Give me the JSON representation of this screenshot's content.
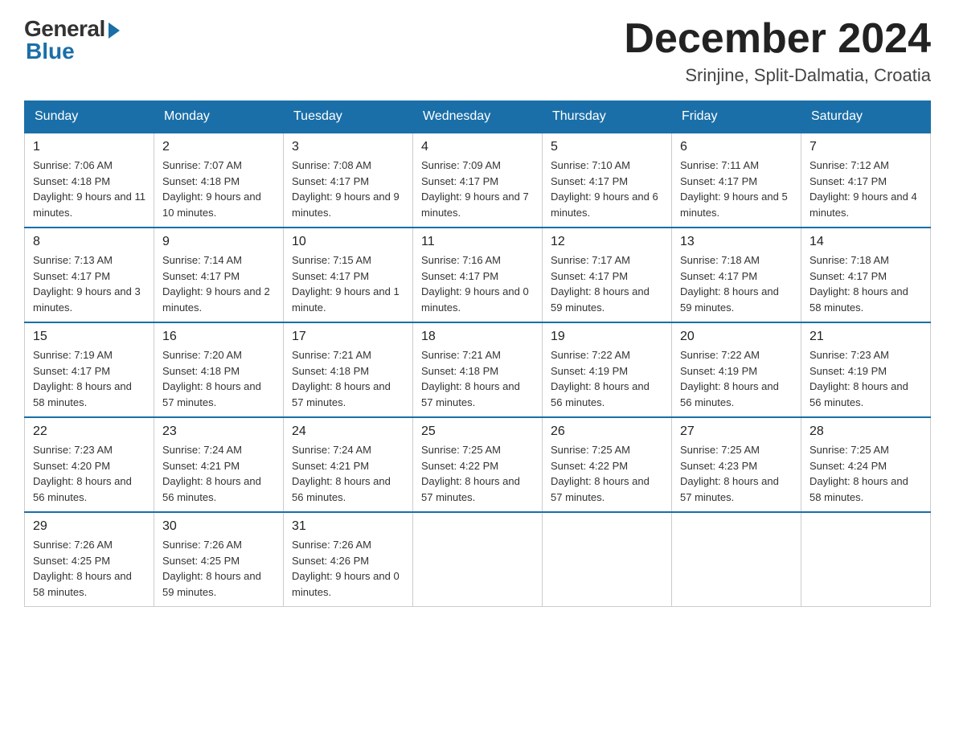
{
  "logo": {
    "general": "General",
    "blue": "Blue"
  },
  "header": {
    "month": "December 2024",
    "location": "Srinjine, Split-Dalmatia, Croatia"
  },
  "weekdays": [
    "Sunday",
    "Monday",
    "Tuesday",
    "Wednesday",
    "Thursday",
    "Friday",
    "Saturday"
  ],
  "weeks": [
    [
      {
        "day": "1",
        "sunrise": "7:06 AM",
        "sunset": "4:18 PM",
        "daylight": "9 hours and 11 minutes."
      },
      {
        "day": "2",
        "sunrise": "7:07 AM",
        "sunset": "4:18 PM",
        "daylight": "9 hours and 10 minutes."
      },
      {
        "day": "3",
        "sunrise": "7:08 AM",
        "sunset": "4:17 PM",
        "daylight": "9 hours and 9 minutes."
      },
      {
        "day": "4",
        "sunrise": "7:09 AM",
        "sunset": "4:17 PM",
        "daylight": "9 hours and 7 minutes."
      },
      {
        "day": "5",
        "sunrise": "7:10 AM",
        "sunset": "4:17 PM",
        "daylight": "9 hours and 6 minutes."
      },
      {
        "day": "6",
        "sunrise": "7:11 AM",
        "sunset": "4:17 PM",
        "daylight": "9 hours and 5 minutes."
      },
      {
        "day": "7",
        "sunrise": "7:12 AM",
        "sunset": "4:17 PM",
        "daylight": "9 hours and 4 minutes."
      }
    ],
    [
      {
        "day": "8",
        "sunrise": "7:13 AM",
        "sunset": "4:17 PM",
        "daylight": "9 hours and 3 minutes."
      },
      {
        "day": "9",
        "sunrise": "7:14 AM",
        "sunset": "4:17 PM",
        "daylight": "9 hours and 2 minutes."
      },
      {
        "day": "10",
        "sunrise": "7:15 AM",
        "sunset": "4:17 PM",
        "daylight": "9 hours and 1 minute."
      },
      {
        "day": "11",
        "sunrise": "7:16 AM",
        "sunset": "4:17 PM",
        "daylight": "9 hours and 0 minutes."
      },
      {
        "day": "12",
        "sunrise": "7:17 AM",
        "sunset": "4:17 PM",
        "daylight": "8 hours and 59 minutes."
      },
      {
        "day": "13",
        "sunrise": "7:18 AM",
        "sunset": "4:17 PM",
        "daylight": "8 hours and 59 minutes."
      },
      {
        "day": "14",
        "sunrise": "7:18 AM",
        "sunset": "4:17 PM",
        "daylight": "8 hours and 58 minutes."
      }
    ],
    [
      {
        "day": "15",
        "sunrise": "7:19 AM",
        "sunset": "4:17 PM",
        "daylight": "8 hours and 58 minutes."
      },
      {
        "day": "16",
        "sunrise": "7:20 AM",
        "sunset": "4:18 PM",
        "daylight": "8 hours and 57 minutes."
      },
      {
        "day": "17",
        "sunrise": "7:21 AM",
        "sunset": "4:18 PM",
        "daylight": "8 hours and 57 minutes."
      },
      {
        "day": "18",
        "sunrise": "7:21 AM",
        "sunset": "4:18 PM",
        "daylight": "8 hours and 57 minutes."
      },
      {
        "day": "19",
        "sunrise": "7:22 AM",
        "sunset": "4:19 PM",
        "daylight": "8 hours and 56 minutes."
      },
      {
        "day": "20",
        "sunrise": "7:22 AM",
        "sunset": "4:19 PM",
        "daylight": "8 hours and 56 minutes."
      },
      {
        "day": "21",
        "sunrise": "7:23 AM",
        "sunset": "4:19 PM",
        "daylight": "8 hours and 56 minutes."
      }
    ],
    [
      {
        "day": "22",
        "sunrise": "7:23 AM",
        "sunset": "4:20 PM",
        "daylight": "8 hours and 56 minutes."
      },
      {
        "day": "23",
        "sunrise": "7:24 AM",
        "sunset": "4:21 PM",
        "daylight": "8 hours and 56 minutes."
      },
      {
        "day": "24",
        "sunrise": "7:24 AM",
        "sunset": "4:21 PM",
        "daylight": "8 hours and 56 minutes."
      },
      {
        "day": "25",
        "sunrise": "7:25 AM",
        "sunset": "4:22 PM",
        "daylight": "8 hours and 57 minutes."
      },
      {
        "day": "26",
        "sunrise": "7:25 AM",
        "sunset": "4:22 PM",
        "daylight": "8 hours and 57 minutes."
      },
      {
        "day": "27",
        "sunrise": "7:25 AM",
        "sunset": "4:23 PM",
        "daylight": "8 hours and 57 minutes."
      },
      {
        "day": "28",
        "sunrise": "7:25 AM",
        "sunset": "4:24 PM",
        "daylight": "8 hours and 58 minutes."
      }
    ],
    [
      {
        "day": "29",
        "sunrise": "7:26 AM",
        "sunset": "4:25 PM",
        "daylight": "8 hours and 58 minutes."
      },
      {
        "day": "30",
        "sunrise": "7:26 AM",
        "sunset": "4:25 PM",
        "daylight": "8 hours and 59 minutes."
      },
      {
        "day": "31",
        "sunrise": "7:26 AM",
        "sunset": "4:26 PM",
        "daylight": "9 hours and 0 minutes."
      },
      null,
      null,
      null,
      null
    ]
  ],
  "labels": {
    "sunrise": "Sunrise:",
    "sunset": "Sunset:",
    "daylight": "Daylight:"
  }
}
